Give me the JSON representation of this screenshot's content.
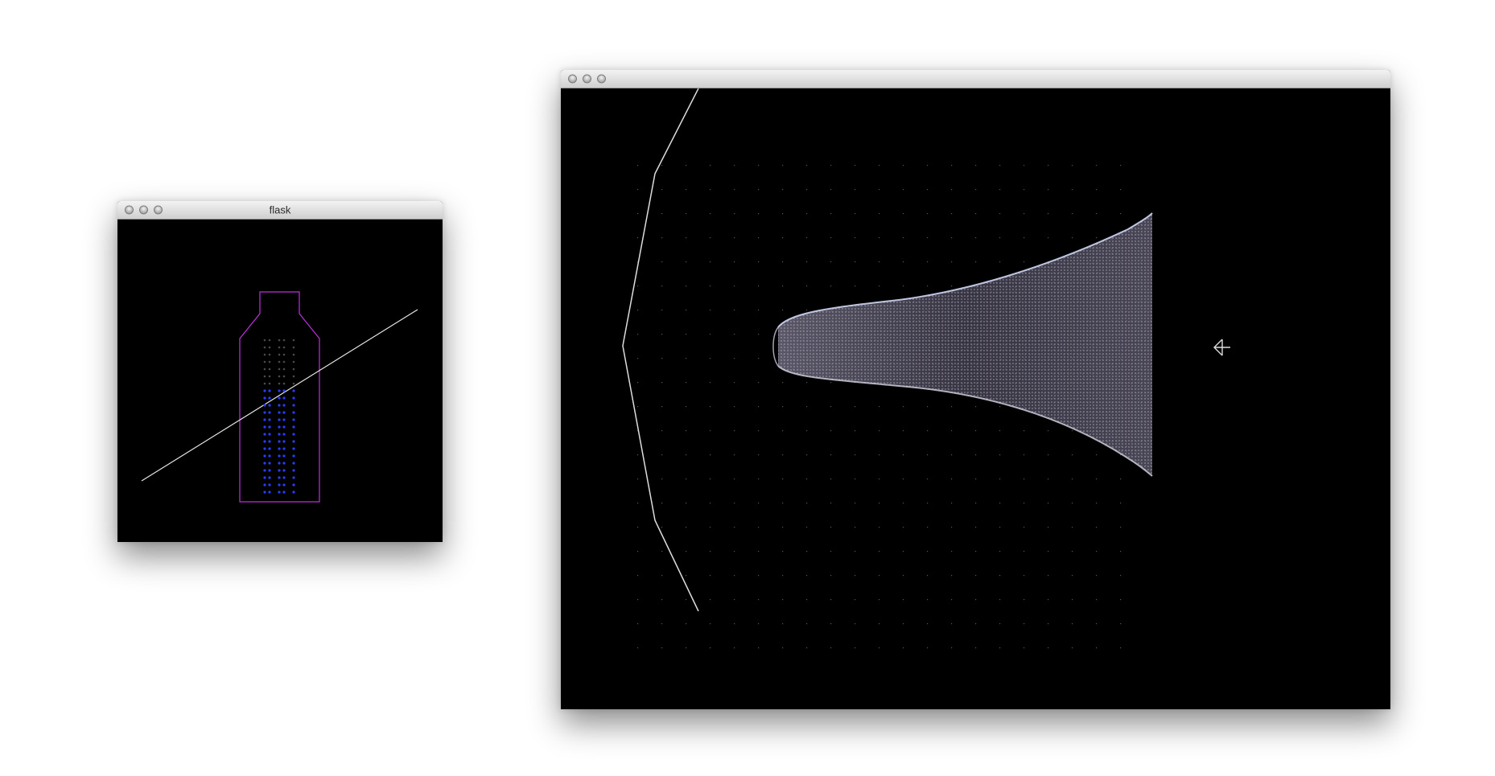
{
  "windows": {
    "flask": {
      "title": "flask",
      "colors": {
        "outline": "#c02ee0",
        "line": "#e6e6e6",
        "particle_active": "#2a3cff",
        "particle_inactive": "#4a4a4a"
      }
    },
    "render": {
      "title": "",
      "colors": {
        "surface": "#b8b4c0",
        "grid_dot": "#555555",
        "boundary_line": "#dddddd",
        "arrow": "#dddddd"
      }
    }
  },
  "icons": {
    "close": "close-icon",
    "minimize": "minimize-icon",
    "zoom": "zoom-icon",
    "arrow": "arrow-left-icon"
  }
}
